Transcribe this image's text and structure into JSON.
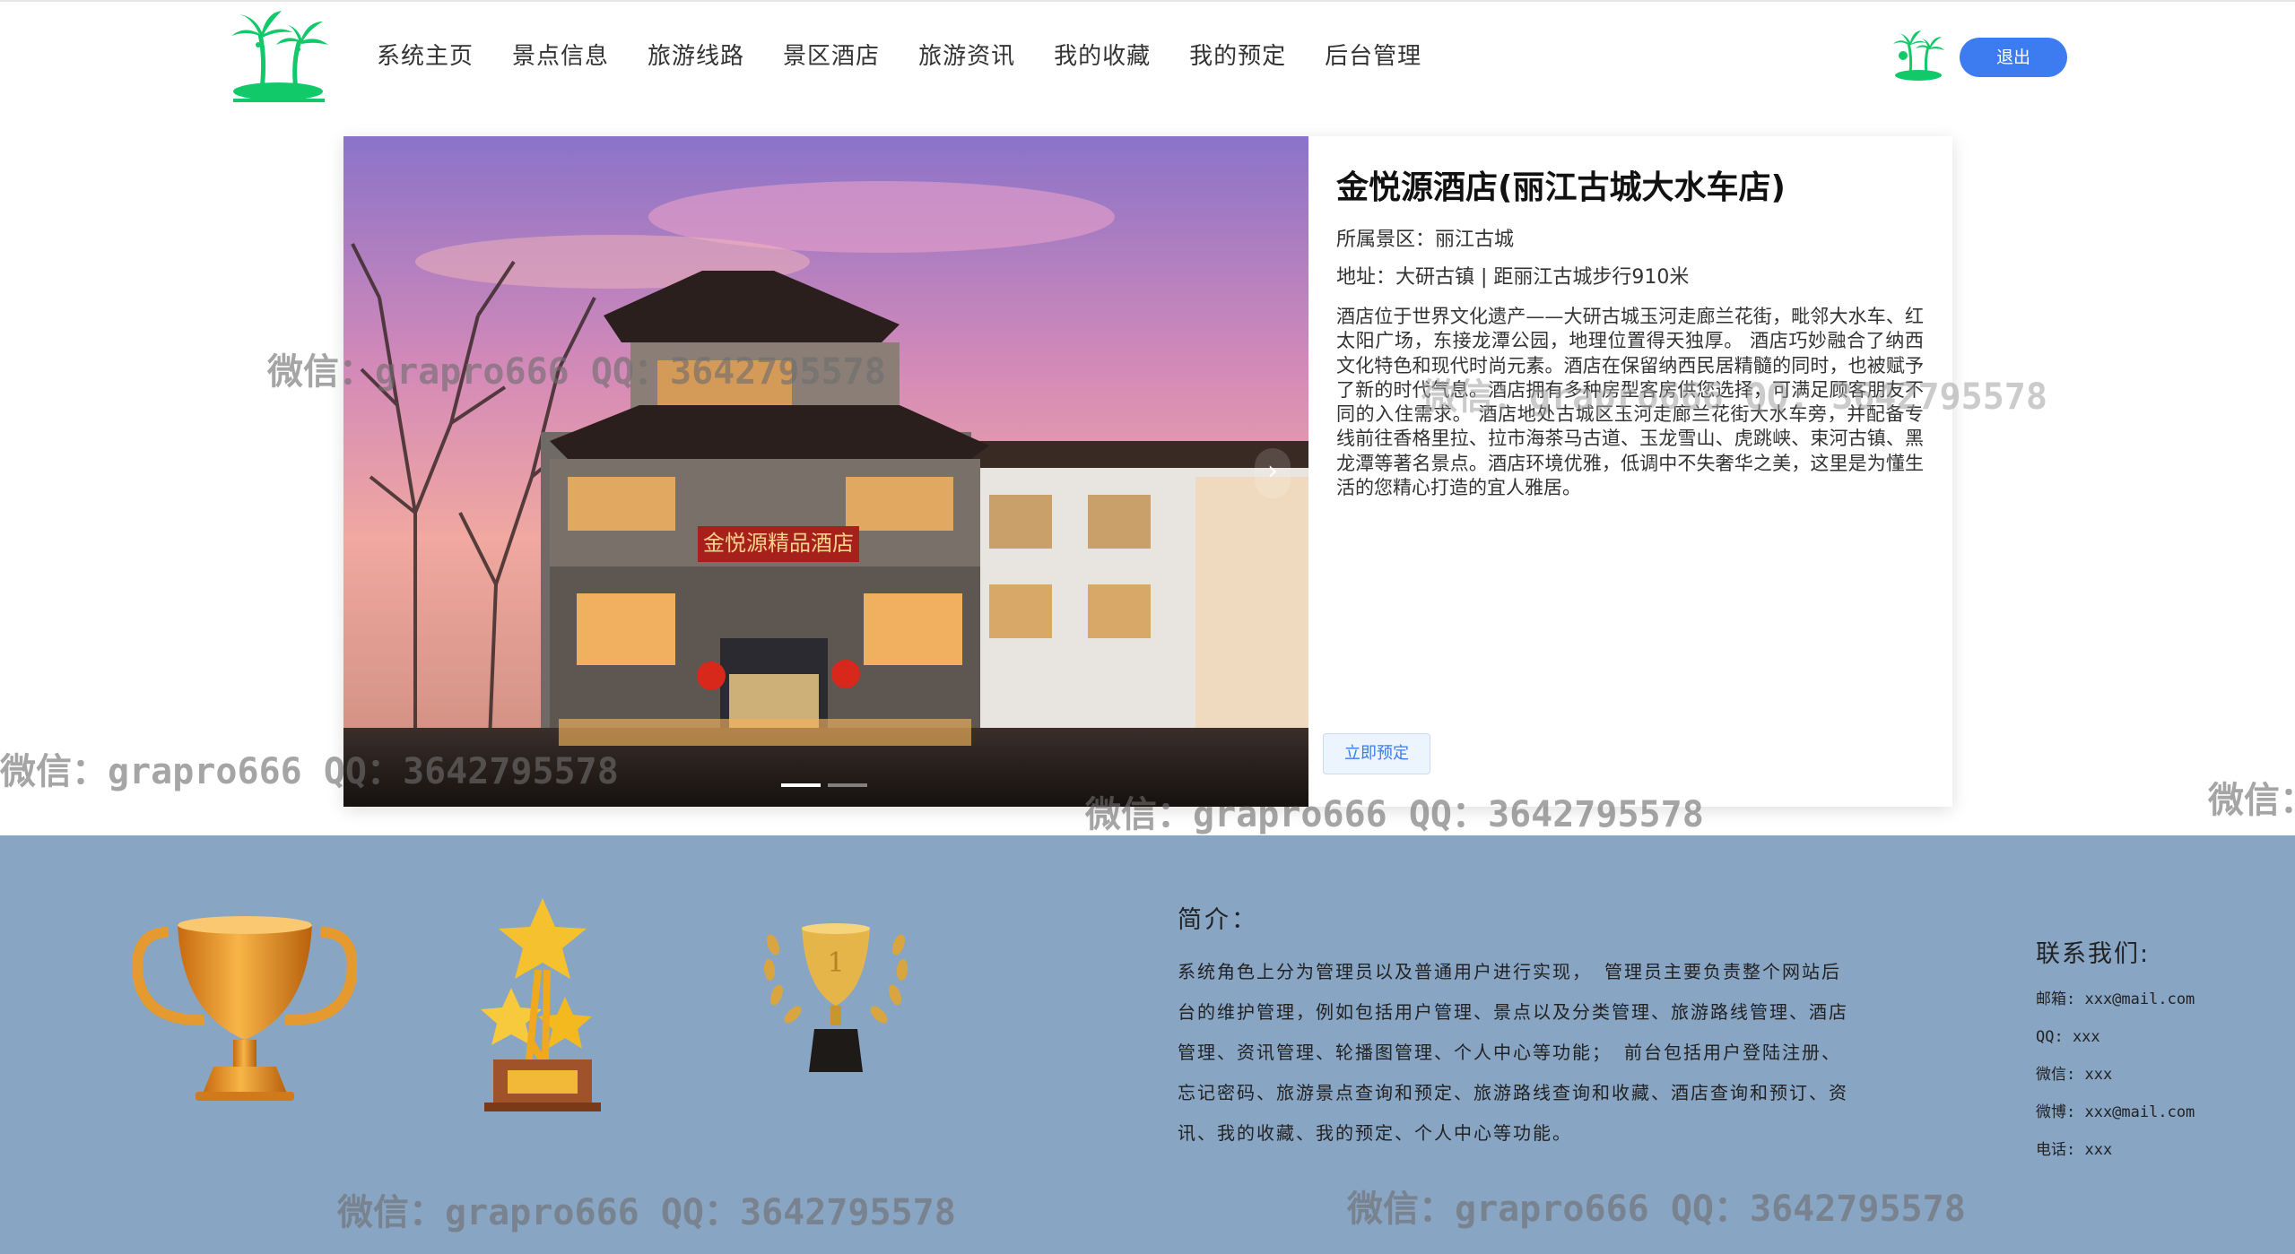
{
  "header": {
    "nav": [
      "系统主页",
      "景点信息",
      "旅游线路",
      "景区酒店",
      "旅游资讯",
      "我的收藏",
      "我的预定",
      "后台管理"
    ],
    "logout_label": "退出",
    "accent_color": "#3d7bf0",
    "logo_icon": "palm-tree-island-icon",
    "avatar_icon": "palm-tree-avatar-icon"
  },
  "hotel": {
    "name": "金悦源酒店(丽江古城大水车店)",
    "scenic_label": "所属景区：丽江古城",
    "address_label": "地址：大研古镇 | 距丽江古城步行910米",
    "description": "酒店位于世界文化遗产——大研古城玉河走廊兰花街，毗邻大水车、红太阳广场，东接龙潭公园，地理位置得天独厚。 酒店巧妙融合了纳西文化特色和现代时尚元素。酒店在保留纳西民居精髓的同时，也被赋予了新的时代气息。酒店拥有多种房型客房供您选择，可满足顾客朋友不同的入住需求。 酒店地处古城区玉河走廊兰花街大水车旁，并配备专线前往香格里拉、拉市海茶马古道、玉龙雪山、虎跳峡、束河古镇、黑龙潭等著名景点。酒店环境优雅，低调中不失奢华之美，这里是为懂生活的您精心打造的宜人雅居。",
    "book_label": "立即预定",
    "sign_text": "金悦源精品酒店",
    "carousel_next_icon": "chevron-right-icon"
  },
  "footer": {
    "intro_title": "简介：",
    "intro_text": "系统角色上分为管理员以及普通用户进行实现， 管理员主要负责整个网站后台的维护管理，例如包括用户管理、景点以及分类管理、旅游路线管理、酒店管理、资讯管理、轮播图管理、个人中心等功能； 前台包括用户登陆注册、忘记密码、旅游景点查询和预定、旅游路线查询和收藏、酒店查询和预订、资讯、我的收藏、我的预定、个人中心等功能。",
    "contact_title": "联系我们:",
    "contacts": [
      "邮箱: xxx@mail.com",
      "QQ: xxx",
      "微信: xxx",
      "微博: xxx@mail.com",
      "电话: xxx"
    ],
    "background_color": "#88a5c4",
    "trophy_icons": [
      "gold-cup-trophy-icon",
      "star-trophy-icon",
      "laurel-trophy-icon"
    ]
  },
  "watermark": {
    "text_a": "微信：grapro666 QQ：3642795578",
    "text_b": "微信：grapro666 QQ: 3642795578",
    "text_edge": "微信："
  }
}
